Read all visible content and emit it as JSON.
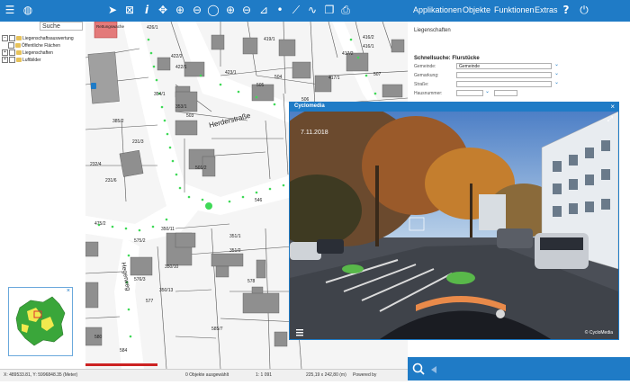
{
  "toolbar": {
    "menu": [
      "Applikationen",
      "Objekte",
      "Funktionen",
      "Extras"
    ],
    "help_glyph": "?",
    "icons": [
      "menu-icon",
      "globe-icon",
      "select-arrow-icon",
      "select-box-icon",
      "info-icon",
      "pan-icon",
      "zoom-in-icon",
      "zoom-out-icon",
      "zoom-box-icon",
      "zoom-in-step-icon",
      "zoom-out-step-icon",
      "zoom-extent-icon",
      "point-icon",
      "measure-line-icon",
      "measure-curve-icon",
      "copy-icon",
      "document-icon",
      "print-icon",
      "help-icon",
      "power-icon"
    ]
  },
  "left_panel": {
    "search_placeholder": "Suche",
    "tree": [
      {
        "label": "Liegenschaftsauswertung",
        "expand": "−",
        "checked": true
      },
      {
        "label": "Öffentliche Flächen",
        "expand": "",
        "checked": false
      },
      {
        "label": "Liegenschaften",
        "expand": "+",
        "checked": false
      },
      {
        "label": "Luftbilder",
        "expand": "+",
        "checked": false
      }
    ]
  },
  "map": {
    "street_labels": [
      "Herderstraße",
      "Hegerweg"
    ],
    "parcel_labels": [
      "426/1",
      "419/1",
      "416/2",
      "416/1",
      "422/2",
      "422/1",
      "423/1",
      "417/2",
      "417/1",
      "504",
      "506",
      "505",
      "507",
      "354/1",
      "353/1",
      "503",
      "385/2",
      "231/3",
      "232/4",
      "231/6",
      "501/2",
      "546",
      "475/2",
      "350/11",
      "575/2",
      "351/1",
      "351/2",
      "576/3",
      "350/10",
      "350/13",
      "578",
      "577",
      "585/7",
      "580",
      "584"
    ],
    "building_label": "Rettungswache"
  },
  "side_panel": {
    "title": "Liegenschaften",
    "subtitle": "Schnellsuche: Flurstücke",
    "fields": [
      {
        "label": "Gemeinde:",
        "value": "Gemeinde"
      },
      {
        "label": "Gemarkung:",
        "value": ""
      },
      {
        "label": "Straße:",
        "value": ""
      },
      {
        "label": "Hausnummer:",
        "value": ""
      }
    ]
  },
  "cyclomedia": {
    "title": "Cyclomedia",
    "date": "7.11.2018",
    "credit": "© CycloMedia"
  },
  "overview": {
    "close_glyph": "×"
  },
  "status_bar": {
    "coords": "X: 489533.81, Y: 5996848.35 (Meter)",
    "selection": "0 Objekte ausgewählt",
    "scale": "1: 1 091",
    "extent": "225,19 x 242,80 (m)",
    "powered_by": "Powered by"
  },
  "colors": {
    "accent": "#1f7bc6",
    "parcel": "#8f8f8f",
    "tree_dots": "#3fd957"
  }
}
